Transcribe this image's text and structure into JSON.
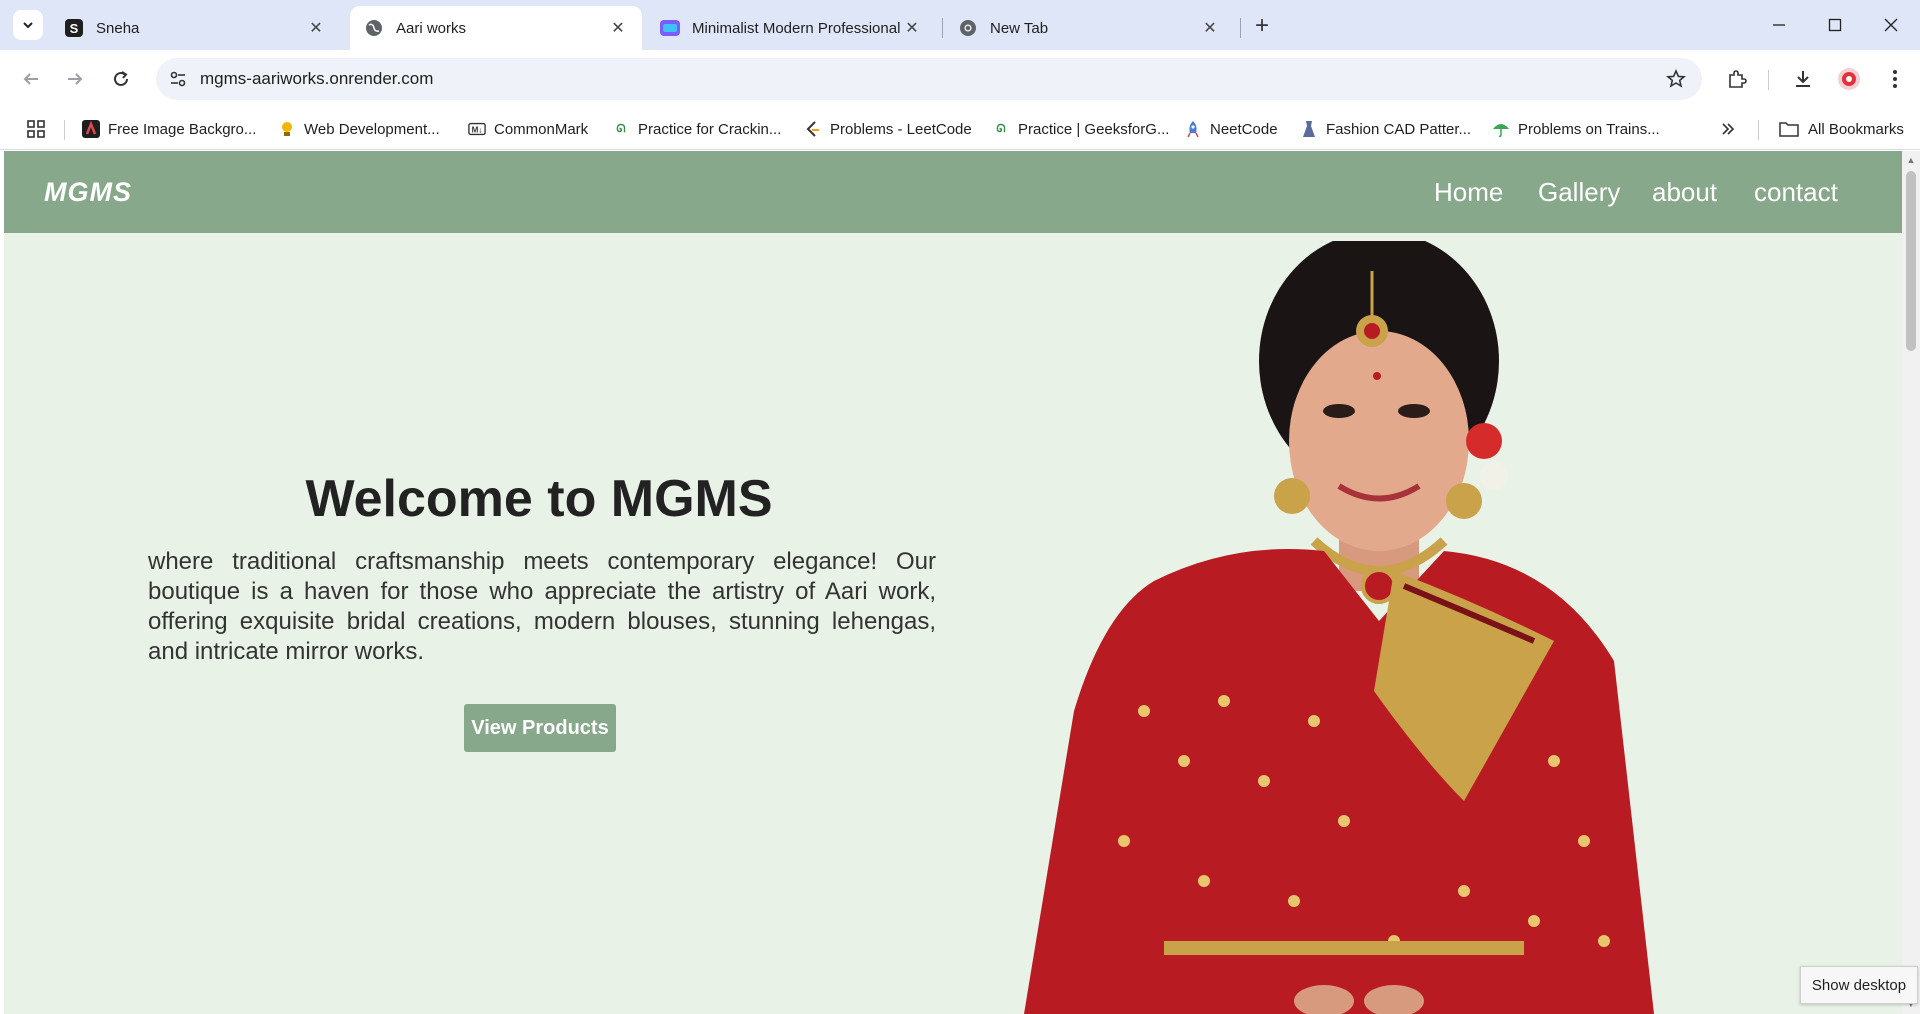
{
  "browser": {
    "tabs": [
      {
        "title": "Sneha",
        "favicon": "s-logo-icon"
      },
      {
        "title": "Aari works",
        "favicon": "globe-icon",
        "active": true
      },
      {
        "title": "Minimalist Modern Professional",
        "favicon": "canva-icon"
      },
      {
        "title": "New Tab",
        "favicon": "chrome-icon"
      }
    ],
    "url": "mgms-aariworks.onrender.com",
    "bookmarks": [
      {
        "label": "Free Image Backgro...",
        "icon": "adobe-icon",
        "color": "#e34850"
      },
      {
        "label": "Web Development...",
        "icon": "bulb-icon",
        "color": "#f4b400"
      },
      {
        "label": "CommonMark",
        "icon": "markdown-icon",
        "color": "#333333"
      },
      {
        "label": "Practice for Crackin...",
        "icon": "gfg-icon",
        "color": "#2f8d46"
      },
      {
        "label": "Problems - LeetCode",
        "icon": "leetcode-icon",
        "color": "#f89f1b"
      },
      {
        "label": "Practice | GeeksforG...",
        "icon": "gfg-icon",
        "color": "#2f8d46"
      },
      {
        "label": "NeetCode",
        "icon": "rocket-icon",
        "color": "#4a7bd0"
      },
      {
        "label": "Fashion CAD Patter...",
        "icon": "dress-icon",
        "color": "#5b6b9a"
      },
      {
        "label": "Problems on Trains...",
        "icon": "umbrella-icon",
        "color": "#3aa757"
      }
    ],
    "all_bookmarks": "All Bookmarks"
  },
  "site": {
    "logo": "MGMS",
    "nav": [
      "Home",
      "Gallery",
      "about",
      "contact"
    ],
    "hero": {
      "title": "Welcome to MGMS",
      "text": "where traditional craftsmanship meets contemporary elegance! Our boutique is a haven for those who appreciate the artistry of Aari work, offering exquisite bridal creations, modern blouses, stunning lehengas, and intricate mirror works.",
      "button": "View Products"
    },
    "colors": {
      "accent": "#87a88a",
      "background": "#e9f2e6",
      "saree": "#b81c22",
      "gold": "#c9a24a"
    }
  },
  "os": {
    "show_desktop": "Show desktop"
  }
}
